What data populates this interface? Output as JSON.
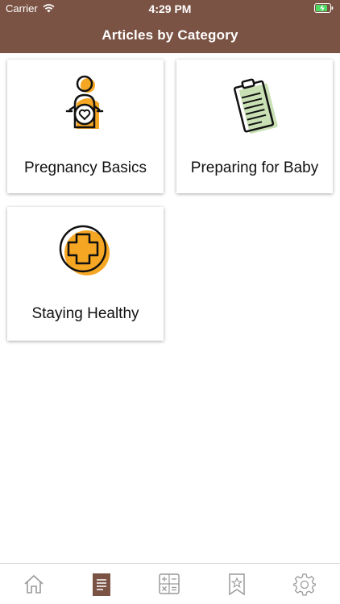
{
  "status_bar": {
    "carrier": "Carrier",
    "time": "4:29 PM"
  },
  "header": {
    "title": "Articles by Category"
  },
  "categories": [
    {
      "label": "Pregnancy Basics",
      "icon": "pregnant-woman-icon"
    },
    {
      "label": "Preparing for Baby",
      "icon": "clipboard-icon"
    },
    {
      "label": "Staying Healthy",
      "icon": "medical-cross-icon"
    }
  ],
  "tab_bar": {
    "tabs": [
      {
        "icon": "home-icon",
        "active": false
      },
      {
        "icon": "articles-icon",
        "active": true
      },
      {
        "icon": "calculator-icon",
        "active": false
      },
      {
        "icon": "bookmark-star-icon",
        "active": false
      },
      {
        "icon": "settings-gear-icon",
        "active": false
      }
    ]
  },
  "colors": {
    "header_bg": "#7b5344",
    "accent_orange": "#f5a623",
    "accent_green": "#c8e0b4",
    "active_tab": "#7b5344",
    "inactive_tab": "#9a9a9a",
    "battery_green": "#4cd964"
  }
}
